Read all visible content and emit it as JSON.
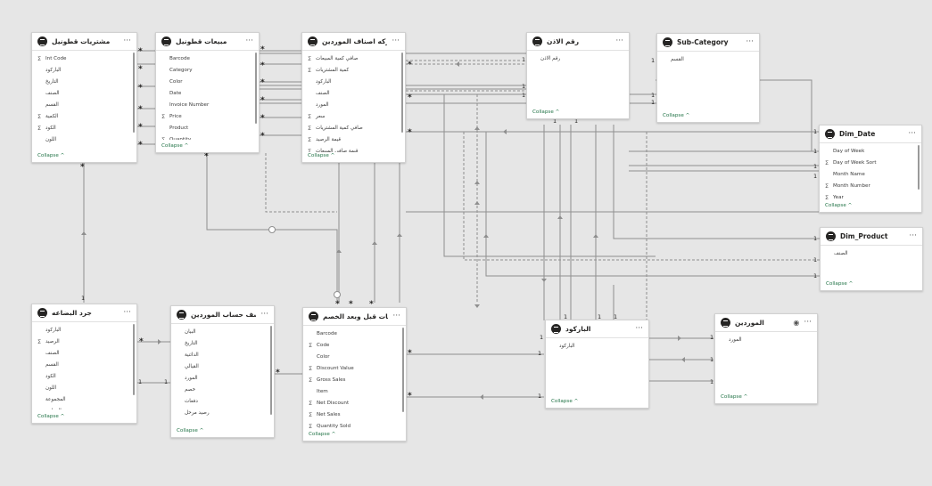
{
  "tables": {
    "purchases": {
      "title": "مشتريات قطونيل",
      "fields": [
        {
          "name": "Int Code",
          "sigma": true
        },
        {
          "name": "الباركود",
          "sigma": false
        },
        {
          "name": "التاريخ",
          "sigma": false
        },
        {
          "name": "الصنف",
          "sigma": false
        },
        {
          "name": "القسم",
          "sigma": false
        },
        {
          "name": "الكمية",
          "sigma": true
        },
        {
          "name": "الكود",
          "sigma": true
        },
        {
          "name": "اللون",
          "sigma": false
        },
        {
          "name": "المقاس",
          "sigma": false
        }
      ],
      "collapse": "Collapse"
    },
    "sales": {
      "title": "مبيعات قطونيل",
      "fields": [
        {
          "name": "Barcode",
          "sigma": false
        },
        {
          "name": "Category",
          "sigma": false
        },
        {
          "name": "Color",
          "sigma": false
        },
        {
          "name": "Date",
          "sigma": false
        },
        {
          "name": "Invoice Number",
          "sigma": false
        },
        {
          "name": "Price",
          "sigma": true
        },
        {
          "name": "Product",
          "sigma": false
        },
        {
          "name": "Quantity",
          "sigma": true
        }
      ],
      "collapse": "Collapse"
    },
    "movement": {
      "title": "حركه اصناف الموردين",
      "fields": [
        {
          "name": "صافي كمية المبيعات",
          "sigma": true
        },
        {
          "name": "كمية المشتريات",
          "sigma": true
        },
        {
          "name": "الباركود",
          "sigma": false
        },
        {
          "name": "الصنف",
          "sigma": false
        },
        {
          "name": "المورد",
          "sigma": false
        },
        {
          "name": "سعر",
          "sigma": true
        },
        {
          "name": "صافي كمية المشتريات",
          "sigma": true
        },
        {
          "name": "قيمة الرصيد",
          "sigma": true
        },
        {
          "name": "قيمة صافي المبيعات",
          "sigma": true
        }
      ],
      "collapse": "Collapse"
    },
    "permit": {
      "title": "رقم الاذن",
      "fields": [
        {
          "name": "رقم الاذن",
          "sigma": false
        }
      ],
      "collapse": "Collapse"
    },
    "subcategory": {
      "title": "Sub-Category",
      "fields": [
        {
          "name": "القسم",
          "sigma": false
        }
      ],
      "collapse": "Collapse"
    },
    "dimdate": {
      "title": "Dim_Date",
      "fields": [
        {
          "name": "Day of Week",
          "sigma": false
        },
        {
          "name": "Day of Week Sort",
          "sigma": true
        },
        {
          "name": "Month Name",
          "sigma": false
        },
        {
          "name": "Month Number",
          "sigma": true
        },
        {
          "name": "Year",
          "sigma": true
        }
      ],
      "collapse": "Collapse"
    },
    "dimproduct": {
      "title": "Dim_Product",
      "fields": [
        {
          "name": "الصنف",
          "sigma": false
        }
      ],
      "collapse": "Collapse"
    },
    "inventory": {
      "title": "جرد البضاعه",
      "fields": [
        {
          "name": "الباركود",
          "sigma": false
        },
        {
          "name": "الرصيد",
          "sigma": true
        },
        {
          "name": "الصنف",
          "sigma": false
        },
        {
          "name": "القسم",
          "sigma": false
        },
        {
          "name": "الكود",
          "sigma": false
        },
        {
          "name": "اللون",
          "sigma": false
        },
        {
          "name": "المجموعة",
          "sigma": false
        },
        {
          "name": "المقاس",
          "sigma": false
        }
      ],
      "collapse": "Collapse"
    },
    "statement": {
      "title": "كشف حساب الموردين",
      "fields": [
        {
          "name": "البيان",
          "sigma": false
        },
        {
          "name": "التاريخ",
          "sigma": false
        },
        {
          "name": "الدائنية",
          "sigma": false
        },
        {
          "name": "القيالي",
          "sigma": false
        },
        {
          "name": "المورد",
          "sigma": false
        },
        {
          "name": "خصم",
          "sigma": false
        },
        {
          "name": "دفعات",
          "sigma": false
        },
        {
          "name": "رصيد مرحل",
          "sigma": false
        }
      ],
      "collapse": "Collapse"
    },
    "salesdisc": {
      "title": "المبيعات قبل وبعد الخصم",
      "fields": [
        {
          "name": "Barcode",
          "sigma": false
        },
        {
          "name": "Code",
          "sigma": true
        },
        {
          "name": "Color",
          "sigma": false
        },
        {
          "name": "Discount Value",
          "sigma": true
        },
        {
          "name": "Gross Sales",
          "sigma": true
        },
        {
          "name": "Item",
          "sigma": false
        },
        {
          "name": "Net Discount",
          "sigma": true
        },
        {
          "name": "Net Sales",
          "sigma": true
        },
        {
          "name": "Quantity Sold",
          "sigma": true
        }
      ],
      "collapse": "Collapse"
    },
    "barcode": {
      "title": "الباركود",
      "fields": [
        {
          "name": "الباركود",
          "sigma": false
        }
      ],
      "collapse": "Collapse"
    },
    "suppliers": {
      "title": "الموردين",
      "fields": [
        {
          "name": "المورد",
          "sigma": false
        }
      ],
      "collapse": "Collapse"
    }
  },
  "symbols": {
    "sigma": "Σ",
    "more": "···",
    "collapse_arrow": "^",
    "many": "*",
    "one": "1"
  }
}
